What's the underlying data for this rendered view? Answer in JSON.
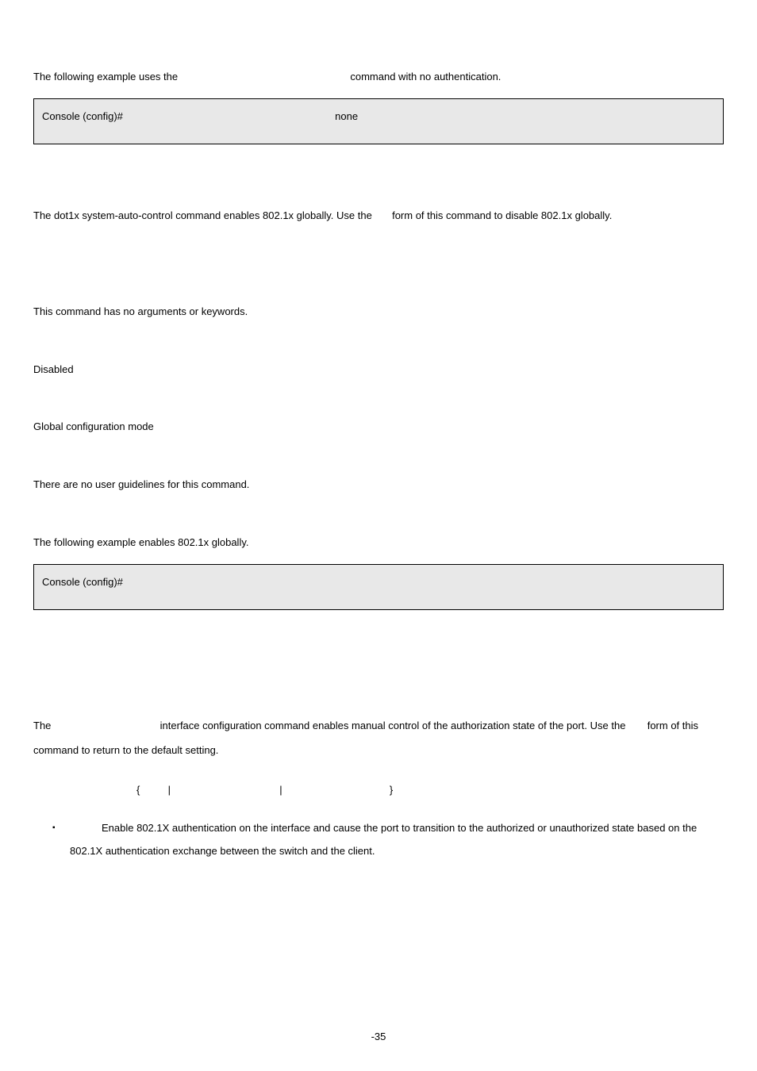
{
  "intro_line_pre": "The following example uses the",
  "intro_line_post": "command with no authentication.",
  "code1_prompt": "Console (config)#",
  "code1_arg": "none",
  "desc1_pre": "The dot1x system-auto-control command enables 802.1x globally. Use the",
  "desc1_post": "form of this command to disable 802.1x globally.",
  "no_args": "This command has no arguments or keywords.",
  "default_val": "Disabled",
  "mode": "Global configuration mode",
  "guidelines": "There are no user guidelines for this command.",
  "example2_intro": "The following example enables 802.1x globally.",
  "code2_prompt": "Console (config)#",
  "port_ctrl_pre": "The",
  "port_ctrl_mid": "interface configuration command enables manual control of the authorization state of the port. Use the",
  "port_ctrl_post": "form of this command to return to the default setting.",
  "syntax_open": "{",
  "syntax_pipe": "|",
  "syntax_close": "}",
  "bullet_text": "Enable 802.1X authentication on the interface and cause the port to transition to the authorized or unauthorized state based on the 802.1X authentication exchange between the switch and the client.",
  "page_number": "-35"
}
